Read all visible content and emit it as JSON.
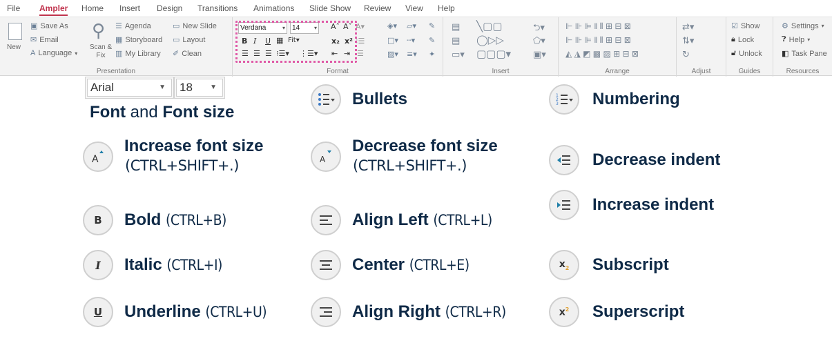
{
  "menu": [
    "File",
    "Ampler",
    "Home",
    "Insert",
    "Design",
    "Transitions",
    "Animations",
    "Slide Show",
    "Review",
    "View",
    "Help"
  ],
  "ribbon": {
    "new": "New",
    "save_as": "Save As",
    "email": "Email",
    "language": "Language",
    "scan_fix": "Scan & Fix",
    "agenda": "Agenda",
    "storyboard": "Storyboard",
    "my_library": "My Library",
    "new_slide": "New Slide",
    "layout": "Layout",
    "clean": "Clean",
    "presentation_label": "Presentation",
    "font_name": "Verdana",
    "font_size": "14",
    "fit": "Fit",
    "format_label": "Format",
    "insert_label": "Insert",
    "arrange_label": "Arrange",
    "show": "Show",
    "lock": "Lock",
    "unlock": "Unlock",
    "adjust_label": "Adjust",
    "guides_label": "Guides",
    "settings": "Settings",
    "help": "Help",
    "task_pane": "Task Pane",
    "resources_label": "Resources"
  },
  "guide": {
    "font_select": "Arial",
    "size_select": "18",
    "font_caption_a": "Font",
    "font_caption_and": "and",
    "font_caption_b": "Font size",
    "bullets": "Bullets",
    "numbering": "Numbering",
    "increase_font": "Increase font size",
    "increase_font_sc": "(CTRL+SHIFT+.)",
    "decrease_font": "Decrease font size",
    "decrease_font_sc": "(CTRL+SHIFT+.)",
    "decrease_indent": "Decrease indent",
    "increase_indent": "Increase indent",
    "bold": "Bold",
    "bold_sc": "(CTRL+B)",
    "align_left": "Align Left",
    "align_left_sc": "(CTRL+L)",
    "italic": "Italic",
    "italic_sc": "(CTRL+I)",
    "center": "Center",
    "center_sc": "(CTRL+E)",
    "subscript": "Subscript",
    "underline": "Underline",
    "underline_sc": "(CTRL+U)",
    "align_right": "Align Right",
    "align_right_sc": "(CTRL+R)",
    "superscript": "Superscript"
  },
  "colors": {
    "accent": "#c0334d",
    "highlight": "#e05aa7",
    "label": "#0f2a47"
  }
}
